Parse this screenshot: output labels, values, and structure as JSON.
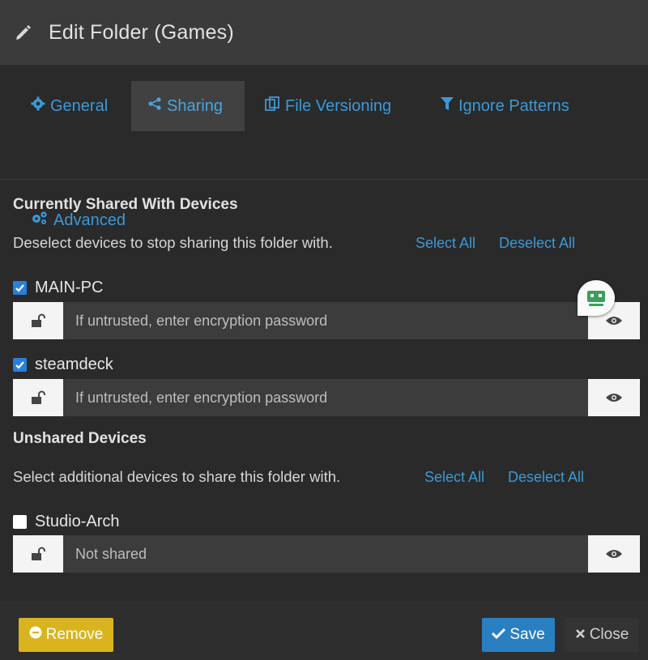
{
  "header": {
    "title": "Edit Folder (Games)",
    "icon": "pencil-icon"
  },
  "tabs": [
    {
      "label": "General",
      "icon": "gear-icon",
      "active": false
    },
    {
      "label": "Sharing",
      "icon": "share-icon",
      "active": true
    },
    {
      "label": "File Versioning",
      "icon": "copy-icon",
      "active": false
    },
    {
      "label": "Ignore Patterns",
      "icon": "filter-icon",
      "active": false
    },
    {
      "label": "Advanced",
      "icon": "gears-icon",
      "active": false
    }
  ],
  "shared": {
    "title": "Currently Shared With Devices",
    "help": "Deselect devices to stop sharing this folder with.",
    "select_all": "Select All",
    "deselect_all": "Deselect All",
    "devices": [
      {
        "name": "MAIN-PC",
        "checked": true,
        "placeholder": "If untrusted, enter encryption password"
      },
      {
        "name": "steamdeck",
        "checked": true,
        "placeholder": "If untrusted, enter encryption password"
      }
    ]
  },
  "unshared": {
    "title": "Unshared Devices",
    "help": "Select additional devices to share this folder with.",
    "select_all": "Select All",
    "deselect_all": "Deselect All",
    "devices": [
      {
        "name": "Studio-Arch",
        "checked": false,
        "placeholder": "Not shared"
      }
    ]
  },
  "footer": {
    "remove_label": "Remove",
    "save_label": "Save",
    "close_label": "Close"
  },
  "colors": {
    "accent_link": "#3a9ad9",
    "remove": "#d9b41e",
    "save": "#2a7fc0",
    "checkbox": "#2a7fdc"
  }
}
